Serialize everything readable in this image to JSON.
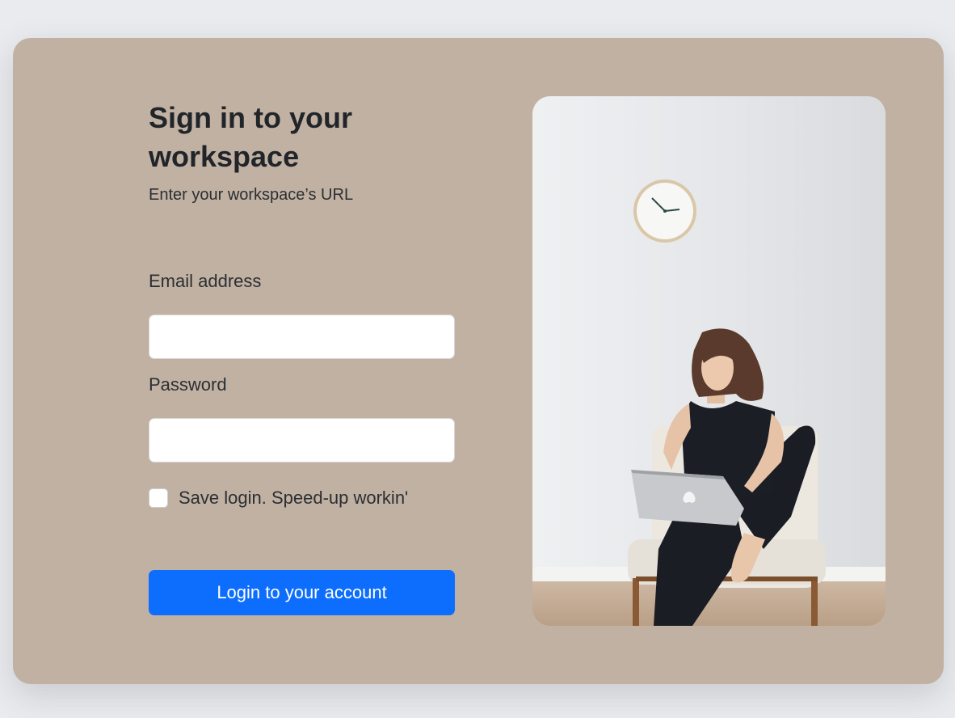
{
  "login": {
    "title": "Sign in to your workspace",
    "subtitle": "Enter your workspace’s URL",
    "email_label": "Email address",
    "email_value": "",
    "password_label": "Password",
    "password_value": "",
    "remember_label": "Save login. Speed-up workin'",
    "remember_checked": false,
    "submit_label": "Login to your account"
  },
  "illustration": {
    "description": "woman-with-laptop-photo"
  },
  "colors": {
    "card_bg": "#c1b1a3",
    "button_bg": "#0d6efd",
    "page_bg": "#e9ebee"
  }
}
